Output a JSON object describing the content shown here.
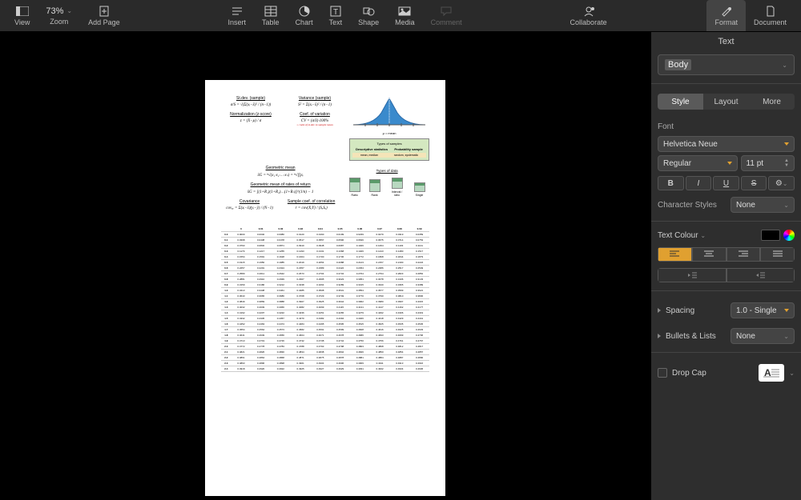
{
  "toolbar": {
    "view": "View",
    "zoom": "Zoom",
    "zoom_value": "73%",
    "add_page": "Add Page",
    "insert": "Insert",
    "table": "Table",
    "chart": "Chart",
    "text": "Text",
    "shape": "Shape",
    "media": "Media",
    "comment": "Comment",
    "collaborate": "Collaborate",
    "format": "Format",
    "document": "Document"
  },
  "sidebar": {
    "title": "Text",
    "paragraph_style": "Body",
    "tabs": [
      "Style",
      "Layout",
      "More"
    ],
    "active_tab": 0,
    "font_section": "Font",
    "font_family": "Helvetica Neue",
    "font_weight": "Regular",
    "font_size": "11 pt",
    "char_styles_label": "Character Styles",
    "char_styles_value": "None",
    "text_colour_label": "Text Colour",
    "text_colour_value": "#000000",
    "spacing_label": "Spacing",
    "spacing_value": "1.0 - Single",
    "bullets_label": "Bullets & Lists",
    "bullets_value": "None",
    "dropcap_label": "Drop Cap",
    "bius": {
      "b": "B",
      "i": "I",
      "u": "U",
      "s": "S"
    }
  },
  "document": {
    "formulas": {
      "stdev_title": "St.dev. (sample)",
      "stdev": "σ/S = √(Σ(xᵢ−x̄)² / (n−1))",
      "variance_title": "Variance (sample)",
      "variance": "S² = Σ(xᵢ−x̄)² / (n−1)",
      "norm_title": "Normalization (z-score)",
      "norm": "z = (X−μ) / σ",
      "cv_title": "Coef. of variation",
      "cv": "CV = (σ/x̄)·100%",
      "cv_note": "= ratio of st.dev to sample mean",
      "geo_title": "Geometric mean",
      "geo": "x̄G = ⁿ√(x₁·x₂·…·xₙ) = ⁿ√∏xᵢ",
      "geo_ror_title": "Geometric mean of rates of return",
      "geo_ror": "x̄G = [(1+R₁)(1+R₂)…(1+Rₙ)]^(1/n) − 1",
      "cov_title": "Covariance",
      "cov": "covₓᵧ = Σ(xᵢ−x̄)(yᵢ−ȳ) / (N−1)",
      "corr_title": "Sample coef. of correlation",
      "corr": "r = cov(X,Y) / (SₓSᵧ)"
    },
    "bell": {
      "caption": "μ = mean",
      "subtitle": "Types of samples",
      "table": {
        "h1": "Descriptive statistics",
        "h2": "Probability sample",
        "r1a": "mean, median",
        "r1b": "random, systematic"
      },
      "bars_title": "Types of data",
      "bars": [
        {
          "label": "Ratio",
          "h": 18
        },
        {
          "label": "Rank",
          "h": 16
        },
        {
          "label": "Interval / ratio",
          "h": 14
        },
        {
          "label": "Single",
          "h": 12
        }
      ]
    },
    "ztable": {
      "cols": [
        "0",
        "0.01",
        "0.02",
        "0.03",
        "0.04",
        "0.05",
        "0.06",
        "0.07",
        "0.08",
        "0.09"
      ],
      "rows": [
        {
          "z": "0.0",
          "v": [
            "0.0000",
            "0.0040",
            "0.0080",
            "0.0120",
            "0.0160",
            "0.0199",
            "0.0239",
            "0.0279",
            "0.0319",
            "0.0359"
          ]
        },
        {
          "z": "0.1",
          "v": [
            "0.0398",
            "0.0438",
            "0.0478",
            "0.0517",
            "0.0557",
            "0.0596",
            "0.0636",
            "0.0675",
            "0.0714",
            "0.0753"
          ]
        },
        {
          "z": "0.2",
          "v": [
            "0.0793",
            "0.0832",
            "0.0871",
            "0.0910",
            "0.0948",
            "0.0987",
            "0.1026",
            "0.1064",
            "0.1103",
            "0.1141"
          ]
        },
        {
          "z": "0.3",
          "v": [
            "0.1179",
            "0.1217",
            "0.1255",
            "0.1293",
            "0.1331",
            "0.1368",
            "0.1406",
            "0.1443",
            "0.1480",
            "0.1517"
          ]
        },
        {
          "z": "0.4",
          "v": [
            "0.1554",
            "0.1591",
            "0.1628",
            "0.1664",
            "0.1700",
            "0.1736",
            "0.1772",
            "0.1808",
            "0.1844",
            "0.1879"
          ]
        },
        {
          "z": "0.5",
          "v": [
            "0.1915",
            "0.1950",
            "0.1985",
            "0.2019",
            "0.2054",
            "0.2088",
            "0.2123",
            "0.2157",
            "0.2190",
            "0.2224"
          ]
        },
        {
          "z": "0.6",
          "v": [
            "0.2257",
            "0.2291",
            "0.2324",
            "0.2357",
            "0.2389",
            "0.2422",
            "0.2454",
            "0.2486",
            "0.2517",
            "0.2549"
          ]
        },
        {
          "z": "0.7",
          "v": [
            "0.2580",
            "0.2611",
            "0.2642",
            "0.2673",
            "0.2704",
            "0.2734",
            "0.2764",
            "0.2794",
            "0.2823",
            "0.2852"
          ]
        },
        {
          "z": "0.8",
          "v": [
            "0.2881",
            "0.2910",
            "0.2939",
            "0.2967",
            "0.2995",
            "0.3023",
            "0.3051",
            "0.3078",
            "0.3106",
            "0.3133"
          ]
        },
        {
          "z": "0.9",
          "v": [
            "0.3159",
            "0.3186",
            "0.3212",
            "0.3238",
            "0.3264",
            "0.3289",
            "0.3315",
            "0.3340",
            "0.3365",
            "0.3389"
          ]
        },
        {
          "z": "1.0",
          "v": [
            "0.3413",
            "0.3438",
            "0.3461",
            "0.3485",
            "0.3508",
            "0.3531",
            "0.3554",
            "0.3577",
            "0.3599",
            "0.3621"
          ]
        },
        {
          "z": "1.1",
          "v": [
            "0.3643",
            "0.3665",
            "0.3686",
            "0.3708",
            "0.3729",
            "0.3749",
            "0.3770",
            "0.3790",
            "0.3810",
            "0.3830"
          ]
        },
        {
          "z": "1.2",
          "v": [
            "0.3849",
            "0.3869",
            "0.3888",
            "0.3907",
            "0.3925",
            "0.3944",
            "0.3962",
            "0.3980",
            "0.3997",
            "0.4015"
          ]
        },
        {
          "z": "1.3",
          "v": [
            "0.4032",
            "0.4049",
            "0.4066",
            "0.4082",
            "0.4099",
            "0.4115",
            "0.4131",
            "0.4147",
            "0.4162",
            "0.4177"
          ]
        },
        {
          "z": "1.4",
          "v": [
            "0.4192",
            "0.4207",
            "0.4222",
            "0.4236",
            "0.4251",
            "0.4265",
            "0.4279",
            "0.4292",
            "0.4306",
            "0.4319"
          ]
        },
        {
          "z": "1.5",
          "v": [
            "0.4332",
            "0.4345",
            "0.4357",
            "0.4370",
            "0.4382",
            "0.4394",
            "0.4406",
            "0.4418",
            "0.4429",
            "0.4441"
          ]
        },
        {
          "z": "1.6",
          "v": [
            "0.4452",
            "0.4463",
            "0.4474",
            "0.4484",
            "0.4495",
            "0.4505",
            "0.4515",
            "0.4525",
            "0.4535",
            "0.4545"
          ]
        },
        {
          "z": "1.7",
          "v": [
            "0.4554",
            "0.4564",
            "0.4573",
            "0.4582",
            "0.4591",
            "0.4599",
            "0.4608",
            "0.4616",
            "0.4625",
            "0.4633"
          ]
        },
        {
          "z": "1.8",
          "v": [
            "0.4641",
            "0.4649",
            "0.4656",
            "0.4664",
            "0.4671",
            "0.4678",
            "0.4686",
            "0.4693",
            "0.4699",
            "0.4706"
          ]
        },
        {
          "z": "1.9",
          "v": [
            "0.4713",
            "0.4719",
            "0.4726",
            "0.4732",
            "0.4738",
            "0.4744",
            "0.4750",
            "0.4756",
            "0.4761",
            "0.4767"
          ]
        },
        {
          "z": "2.0",
          "v": [
            "0.4772",
            "0.4778",
            "0.4783",
            "0.4788",
            "0.4793",
            "0.4798",
            "0.4803",
            "0.4808",
            "0.4812",
            "0.4817"
          ]
        },
        {
          "z": "2.1",
          "v": [
            "0.4821",
            "0.4826",
            "0.4830",
            "0.4834",
            "0.4838",
            "0.4842",
            "0.4846",
            "0.4850",
            "0.4854",
            "0.4857"
          ]
        },
        {
          "z": "2.2",
          "v": [
            "0.4861",
            "0.4864",
            "0.4868",
            "0.4871",
            "0.4875",
            "0.4878",
            "0.4881",
            "0.4884",
            "0.4887",
            "0.4890"
          ]
        },
        {
          "z": "2.3",
          "v": [
            "0.4893",
            "0.4896",
            "0.4898",
            "0.4901",
            "0.4904",
            "0.4906",
            "0.4909",
            "0.4911",
            "0.4913",
            "0.4916"
          ]
        },
        {
          "z": "2.4",
          "v": [
            "0.4918",
            "0.4920",
            "0.4922",
            "0.4925",
            "0.4927",
            "0.4929",
            "0.4931",
            "0.4932",
            "0.4934",
            "0.4936"
          ]
        }
      ]
    }
  }
}
